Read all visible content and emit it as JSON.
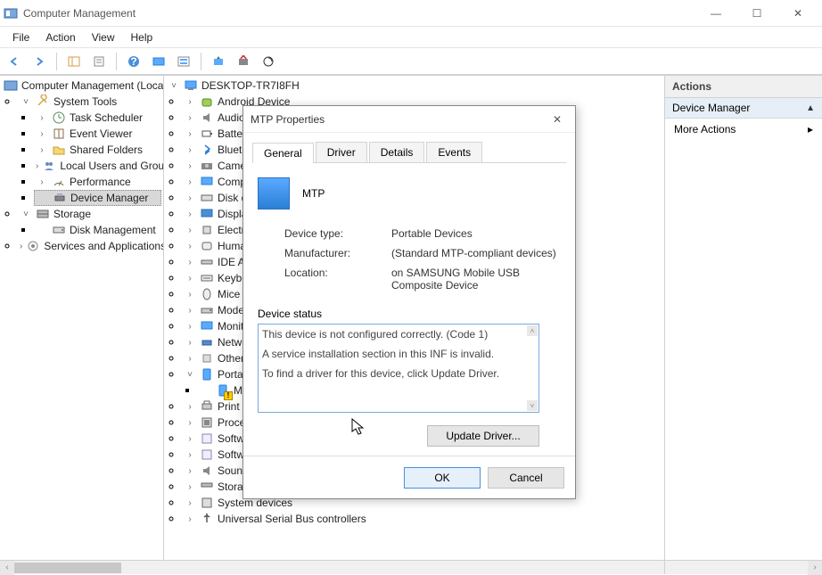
{
  "window": {
    "title": "Computer Management",
    "menu": [
      "File",
      "Action",
      "View",
      "Help"
    ]
  },
  "left_tree": {
    "root": "Computer Management (Local)",
    "system_tools": "System Tools",
    "task_scheduler": "Task Scheduler",
    "event_viewer": "Event Viewer",
    "shared_folders": "Shared Folders",
    "local_users": "Local Users and Groups",
    "performance": "Performance",
    "device_manager": "Device Manager",
    "storage": "Storage",
    "disk_management": "Disk Management",
    "services": "Services and Applications"
  },
  "device_tree": {
    "root": "DESKTOP-TR7I8FH",
    "items": [
      "Android Device",
      "Audio inputs and outputs",
      "Batteries",
      "Bluetooth",
      "Cameras",
      "Computer",
      "Disk drives",
      "Display adapters",
      "Electronic equipment",
      "Human Interface Devices",
      "IDE ATA/ATAPI controllers",
      "Keyboards",
      "Mice and other pointing devices",
      "Modems",
      "Monitors",
      "Network adapters",
      "Other devices",
      "Portable Devices",
      "Print queues",
      "Processors",
      "Software components",
      "Software devices",
      "Sound, video and game controllers",
      "Storage controllers",
      "System devices",
      "Universal Serial Bus controllers"
    ],
    "portable_child": "MTP"
  },
  "actions": {
    "header": "Actions",
    "sub": "Device Manager",
    "more": "More Actions"
  },
  "dialog": {
    "title": "MTP Properties",
    "tabs": [
      "General",
      "Driver",
      "Details",
      "Events"
    ],
    "device_name": "MTP",
    "type_lbl": "Device type:",
    "type_val": "Portable Devices",
    "mfr_lbl": "Manufacturer:",
    "mfr_val": "(Standard MTP-compliant devices)",
    "loc_lbl": "Location:",
    "loc_val": "on SAMSUNG Mobile USB Composite Device",
    "status_hdr": "Device status",
    "status_l1": "This device is not configured correctly. (Code 1)",
    "status_l2": "A service installation section in this INF is invalid.",
    "status_l3": "To find a driver for this device, click Update Driver.",
    "update_btn": "Update Driver...",
    "ok": "OK",
    "cancel": "Cancel"
  }
}
